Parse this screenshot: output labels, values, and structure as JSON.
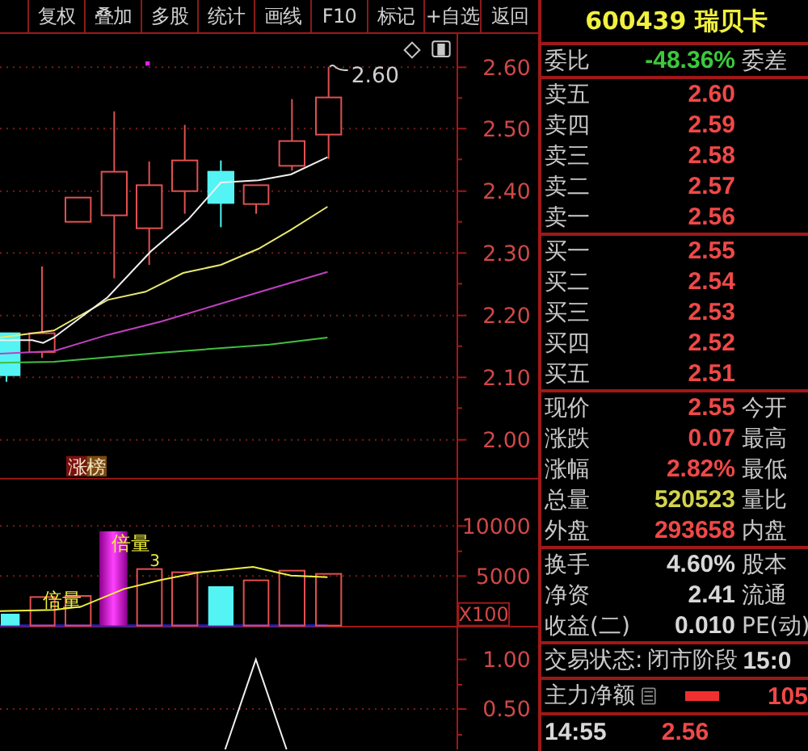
{
  "toolbar": [
    "复权",
    "叠加",
    "多股",
    "统计",
    "画线",
    "F10",
    "标记",
    "+自选",
    "返回"
  ],
  "chart": {
    "price_axis": [
      "2.60",
      "2.50",
      "2.40",
      "2.30",
      "2.20",
      "2.10",
      "2.00"
    ],
    "last_price_label": "2.60",
    "badge": "涨榜",
    "volume_marks": [
      "倍量",
      "倍量",
      "3"
    ],
    "volume_axis": [
      "10000",
      "5000"
    ],
    "volume_unit": "X100",
    "indicator_axis": [
      "1.00",
      "0.50"
    ]
  },
  "quote": {
    "title": "600439 瑞贝卡",
    "ratio": {
      "label": "委比",
      "value": "-48.36%",
      "label2": "委差"
    },
    "asks": [
      {
        "label": "卖五",
        "price": "2.60"
      },
      {
        "label": "卖四",
        "price": "2.59"
      },
      {
        "label": "卖三",
        "price": "2.58"
      },
      {
        "label": "卖二",
        "price": "2.57"
      },
      {
        "label": "卖一",
        "price": "2.56"
      }
    ],
    "bids": [
      {
        "label": "买一",
        "price": "2.55"
      },
      {
        "label": "买二",
        "price": "2.54"
      },
      {
        "label": "买三",
        "price": "2.53"
      },
      {
        "label": "买四",
        "price": "2.52"
      },
      {
        "label": "买五",
        "price": "2.51"
      }
    ],
    "stats": [
      {
        "label": "现价",
        "value": "2.55",
        "label2": "今开",
        "color": "#f04848"
      },
      {
        "label": "涨跌",
        "value": "0.07",
        "label2": "最高",
        "color": "#f04848"
      },
      {
        "label": "涨幅",
        "value": "2.82%",
        "label2": "最低",
        "color": "#f04848"
      },
      {
        "label": "总量",
        "value": "520523",
        "label2": "量比",
        "color": "#d4d44c"
      },
      {
        "label": "外盘",
        "value": "293658",
        "label2": "内盘",
        "color": "#f04848"
      }
    ],
    "fundamentals": [
      {
        "label": "换手",
        "value": "4.60%",
        "label2": "股本"
      },
      {
        "label": "净资",
        "value": "2.41",
        "label2": "流通"
      },
      {
        "label": "收益(二)",
        "value": "0.010",
        "label2": "PE(动)"
      }
    ],
    "status": {
      "label": "交易状态:",
      "value": "闭市阶段",
      "time": "15:0"
    },
    "main_flow": {
      "label": "主力净额",
      "value": "105"
    },
    "tick": {
      "time": "14:55",
      "price": "2.56"
    }
  }
}
